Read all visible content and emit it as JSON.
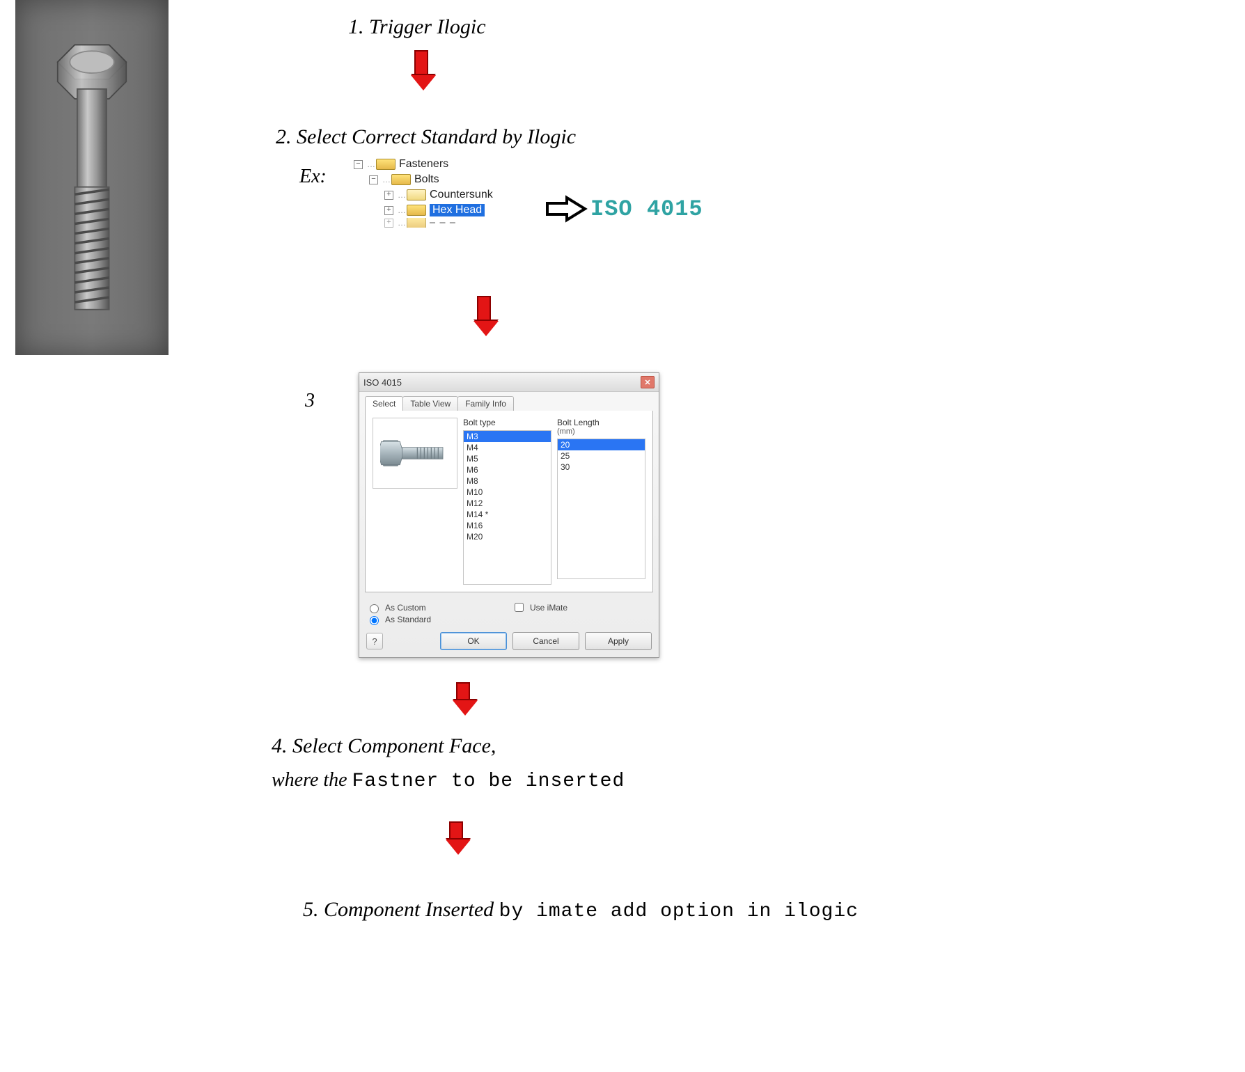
{
  "steps": {
    "s1": "1. Trigger Ilogic",
    "s2": "2. Select Correct Standard by Ilogic",
    "ex": "Ex:",
    "iso_label": "ISO 4015",
    "s3": "3",
    "s4a": "4. Select Component Face,",
    "s4b_it": "where the ",
    "s4b_mono": "Fastner to be inserted",
    "s5_it": "5. Component Inserted ",
    "s5_mono": "by imate add option in ilogic"
  },
  "tree": {
    "fasteners": "Fasteners",
    "bolts": "Bolts",
    "countersunk": "Countersunk",
    "hexhead": "Hex Head"
  },
  "dialog": {
    "title": "ISO 4015",
    "tabs": {
      "select": "Select",
      "table": "Table View",
      "family": "Family Info"
    },
    "col1_hdr": "Bolt type",
    "col2_hdr": "Bolt Length",
    "col2_sub": "(mm)",
    "bolt_types": [
      "M3",
      "M4",
      "M5",
      "M6",
      "M8",
      "M10",
      "M12",
      "M14 *",
      "M16",
      "M20"
    ],
    "lengths": [
      "20",
      "25",
      "30"
    ],
    "sel_type_index": 0,
    "sel_len_index": 0,
    "as_custom": "As Custom",
    "as_standard": "As Standard",
    "use_imate": "Use iMate",
    "ok": "OK",
    "cancel": "Cancel",
    "apply": "Apply"
  }
}
